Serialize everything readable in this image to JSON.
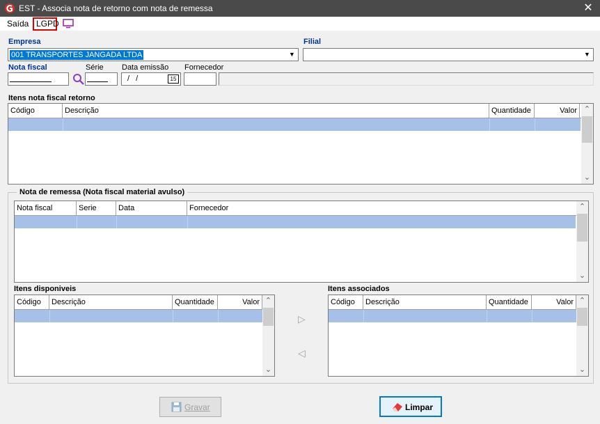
{
  "window": {
    "title": "EST - Associa nota de retorno com nota de remessa",
    "close": "✕"
  },
  "menu": {
    "saida": "Saída",
    "lgpd": "LGPD"
  },
  "form": {
    "empresa_label": "Empresa",
    "empresa_value": "001 TRANSPORTES JANGADA LTDA",
    "filial_label": "Filial",
    "filial_value": "",
    "nota_fiscal_label": "Nota fiscal",
    "nota_fiscal_value": "",
    "serie_label": "Série",
    "data_emissao_label": "Data emissão",
    "data_emissao_value": "/ /",
    "calendar_value": "15",
    "fornecedor_label": "Fornecedor"
  },
  "itens_retorno": {
    "title": "Itens nota fiscal retorno",
    "columns": [
      "Código",
      "Descrição",
      "Quantidade",
      "Valor"
    ]
  },
  "nota_remessa": {
    "title": "Nota de remessa (Nota fiscal material avulso)",
    "columns": [
      "Nota fiscal",
      "Serie",
      "Data",
      "Fornecedor"
    ]
  },
  "itens_disponiveis": {
    "title": "Itens disponiveis",
    "columns": [
      "Código",
      "Descrição",
      "Quantidade",
      "Valor"
    ]
  },
  "itens_associados": {
    "title": "Itens associados",
    "columns": [
      "Código",
      "Descrição",
      "Quantidade",
      "Valor"
    ]
  },
  "transfer": {
    "right": "▷",
    "left": "◁"
  },
  "buttons": {
    "gravar": "Gravar",
    "limpar": "Limpar"
  },
  "scroll": {
    "up": "⌃",
    "down": "⌄"
  },
  "icons": {
    "app": "app-logo-icon",
    "search": "search-icon",
    "calendar": "calendar-icon",
    "monitor": "monitor-icon",
    "save": "floppy-disk-icon",
    "eraser": "eraser-icon"
  },
  "colors": {
    "selection": "#a6c0e8",
    "titlebar": "#4a4a4a",
    "label_blue": "#003399",
    "lgpd_border": "#e00000"
  }
}
